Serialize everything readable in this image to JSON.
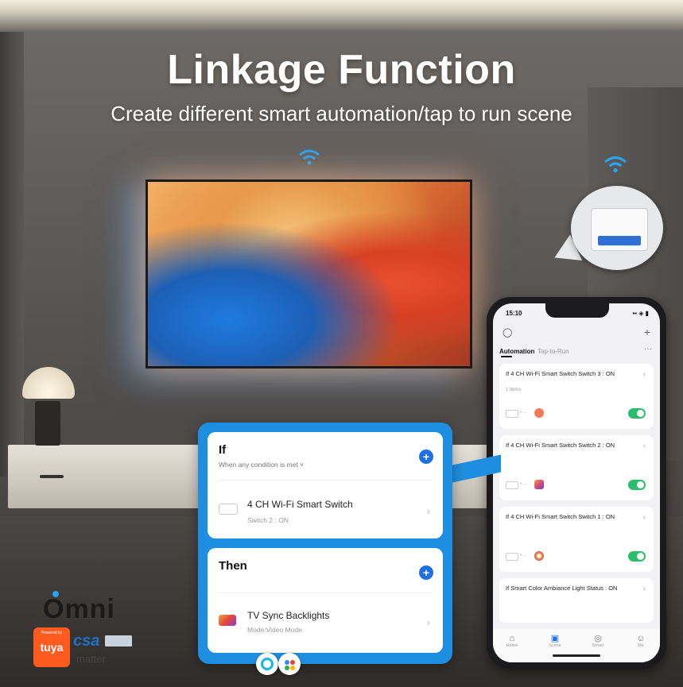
{
  "hero": {
    "title": "Linkage Function",
    "subtitle": "Create different smart automation/tap to run scene"
  },
  "icons": {
    "wifi": "wifi-icon",
    "switch_module": "smart-switch-module",
    "tv": "tv-icon"
  },
  "phone": {
    "status_time": "15:10",
    "status_icons": "▪▪ ◈ ▮",
    "tabs": [
      {
        "label": "Automation",
        "active": true
      },
      {
        "label": "Tap-to-Run",
        "active": false
      }
    ],
    "more": "···",
    "cards": [
      {
        "title": "If 4 CH Wi-Fi Smart Switch  Switch 3 : ON",
        "sub": "1 items",
        "enabled": true,
        "scene_color": "#f07a5a"
      },
      {
        "title": "If 4 CH Wi-Fi Smart Switch  Switch 2 : ON",
        "sub": "",
        "enabled": true,
        "scene_color": "#d94b7a"
      },
      {
        "title": "If 4 CH Wi-Fi Smart Switch  Switch 1 : ON",
        "sub": "",
        "enabled": true,
        "scene_color": "#e7a13a"
      },
      {
        "title": "If Smart Color Ambiance Light  Status : ON",
        "sub": "",
        "enabled": false,
        "scene_color": ""
      }
    ],
    "nav": [
      {
        "label": "Home",
        "icon": "home-icon",
        "glyph": "⌂"
      },
      {
        "label": "Scene",
        "icon": "scene-icon",
        "glyph": "▣"
      },
      {
        "label": "Smart",
        "icon": "smart-icon",
        "glyph": "◎"
      },
      {
        "label": "Me",
        "icon": "me-icon",
        "glyph": "☺"
      }
    ]
  },
  "panel": {
    "if": {
      "heading": "If",
      "condition": "When any condition is met ˅",
      "add": "+",
      "row_title": "4 CH Wi-Fi Smart Switch",
      "row_sub": "Switch 2 : ON",
      "chev": "›"
    },
    "then": {
      "heading": "Then",
      "add": "+",
      "row_title": "TV Sync Backlights",
      "row_sub": "Mode:Video Mode",
      "chev": "›"
    }
  },
  "branding": {
    "omni": "Omni",
    "tuya_small": "Powered by",
    "tuya": "tuya",
    "csa": "csa",
    "matter": "matter"
  },
  "colors": {
    "accent_blue": "#1e8fe0",
    "button_blue": "#1f6fe5",
    "toggle_green": "#2bbd6b",
    "tuya_orange": "#ff5a1f"
  }
}
